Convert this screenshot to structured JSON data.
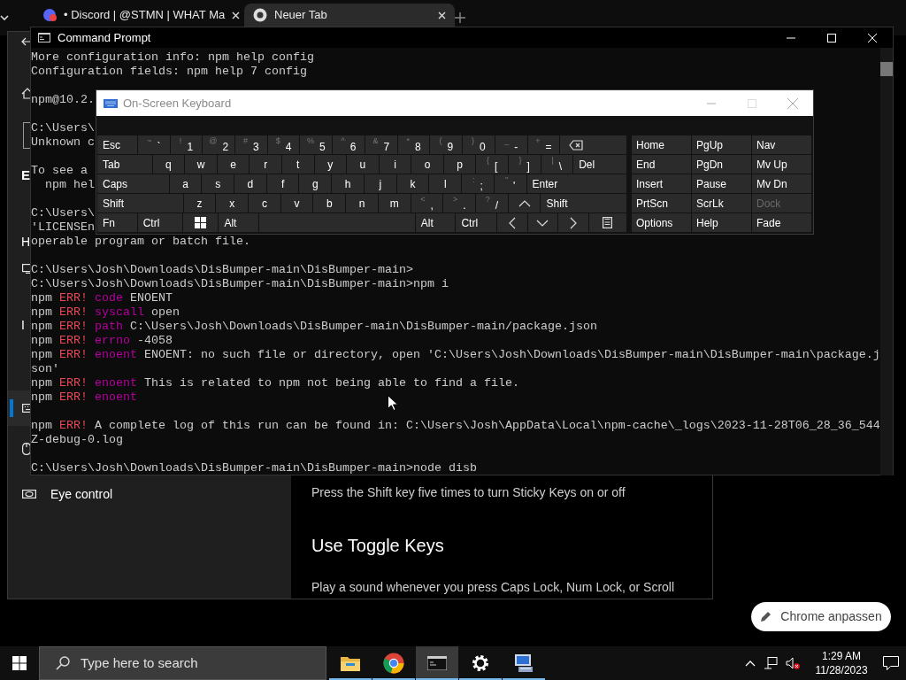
{
  "browser": {
    "tabs": [
      {
        "title": "• Discord | @STMN | WHAT Ma",
        "selected": false
      },
      {
        "title": "Neuer Tab",
        "selected": true
      }
    ],
    "customize_button": "Chrome anpassen"
  },
  "settings": {
    "sidebar": [
      {
        "kind": "back"
      },
      {
        "kind": "home"
      },
      {
        "kind": "search"
      },
      {
        "kind": "heading",
        "label": "E"
      },
      {
        "kind": "label",
        "label": "H"
      },
      {
        "kind": "item",
        "selected": false
      },
      {
        "kind": "label",
        "label": "I"
      },
      {
        "kind": "item",
        "selected": true
      },
      {
        "kind": "item",
        "selected": false
      },
      {
        "kind": "item",
        "label": "Eye control",
        "selected": false
      }
    ],
    "content": [
      {
        "kind": "text",
        "text": "Press the Shift key five times to turn Sticky Keys on or off"
      },
      {
        "kind": "heading",
        "text": "Use Toggle Keys"
      },
      {
        "kind": "text",
        "text": "Play a sound whenever you press Caps Lock, Num Lock, or Scroll"
      }
    ]
  },
  "console": {
    "title": "Command Prompt",
    "lines": [
      {
        "kind": "plain",
        "text": "More configuration info: npm help config"
      },
      {
        "kind": "plain",
        "text": "Configuration fields: npm help 7 config"
      },
      {
        "kind": "blank"
      },
      {
        "kind": "plain",
        "text": "npm@10.2."
      },
      {
        "kind": "blank"
      },
      {
        "kind": "plain",
        "text": "C:\\Users\\"
      },
      {
        "kind": "plain",
        "text": "Unknown c"
      },
      {
        "kind": "blank"
      },
      {
        "kind": "plain",
        "text": "To see a"
      },
      {
        "kind": "plain",
        "text": "  npm hel"
      },
      {
        "kind": "blank"
      },
      {
        "kind": "plain",
        "text": "C:\\Users\\"
      },
      {
        "kind": "plain",
        "text": "'LICENSEn"
      },
      {
        "kind": "plain",
        "text": "operable program or batch file."
      },
      {
        "kind": "blank"
      },
      {
        "kind": "plain",
        "text": "C:\\Users\\Josh\\Downloads\\DisBumper-main\\DisBumper-main>"
      },
      {
        "kind": "plain",
        "text": "C:\\Users\\Josh\\Downloads\\DisBumper-main\\DisBumper-main>npm i"
      },
      {
        "kind": "err",
        "prefix": "npm",
        "tag": "ERR!",
        "key": "code",
        "rest": "ENOENT"
      },
      {
        "kind": "err",
        "prefix": "npm",
        "tag": "ERR!",
        "key": "syscall",
        "rest": "open"
      },
      {
        "kind": "err",
        "prefix": "npm",
        "tag": "ERR!",
        "key": "path",
        "rest": "C:\\Users\\Josh\\Downloads\\DisBumper-main\\DisBumper-main/package.json"
      },
      {
        "kind": "err",
        "prefix": "npm",
        "tag": "ERR!",
        "key": "errno",
        "rest": "-4058"
      },
      {
        "kind": "err",
        "prefix": "npm",
        "tag": "ERR!",
        "key": "enoent",
        "rest": "ENOENT: no such file or directory, open 'C:\\Users\\Josh\\Downloads\\DisBumper-main\\DisBumper-main\\package.j"
      },
      {
        "kind": "plain",
        "text": "son'"
      },
      {
        "kind": "err",
        "prefix": "npm",
        "tag": "ERR!",
        "key": "enoent",
        "rest": "This is related to npm not being able to find a file."
      },
      {
        "kind": "err",
        "prefix": "npm",
        "tag": "ERR!",
        "key": "enoent"
      },
      {
        "kind": "blank"
      },
      {
        "kind": "err",
        "prefix": "npm",
        "tag": "ERR!",
        "rest": "A complete log of this run can be found in: C:\\Users\\Josh\\AppData\\Local\\npm-cache\\_logs\\2023-11-28T06_28_36_544"
      },
      {
        "kind": "plain",
        "text": "Z-debug-0.log"
      },
      {
        "kind": "blank"
      },
      {
        "kind": "plain",
        "text": "C:\\Users\\Josh\\Downloads\\DisBumper-main\\DisBumper-main>node disb"
      }
    ]
  },
  "keyboard": {
    "title": "On-Screen Keyboard",
    "rows": [
      [
        {
          "kind": "key",
          "label": "Esc"
        },
        {
          "kind": "dual",
          "shift": "~",
          "main": "`"
        },
        {
          "kind": "dual",
          "shift": "!",
          "main": "1"
        },
        {
          "kind": "dual",
          "shift": "@",
          "main": "2"
        },
        {
          "kind": "dual",
          "shift": "#",
          "main": "3"
        },
        {
          "kind": "dual",
          "shift": "$",
          "main": "4"
        },
        {
          "kind": "dual",
          "shift": "%",
          "main": "5"
        },
        {
          "kind": "dual",
          "shift": "^",
          "main": "6"
        },
        {
          "kind": "dual",
          "shift": "&",
          "main": "7"
        },
        {
          "kind": "dual",
          "shift": "*",
          "main": "8"
        },
        {
          "kind": "dual",
          "shift": "(",
          "main": "9"
        },
        {
          "kind": "dual",
          "shift": ")",
          "main": "0"
        },
        {
          "kind": "dual",
          "shift": "_",
          "main": "-"
        },
        {
          "kind": "dual",
          "shift": "+",
          "main": "="
        },
        {
          "kind": "backspace"
        }
      ],
      [
        {
          "kind": "key",
          "label": "Tab"
        },
        {
          "kind": "letter",
          "label": "q"
        },
        {
          "kind": "letter",
          "label": "w"
        },
        {
          "kind": "letter",
          "label": "e"
        },
        {
          "kind": "letter",
          "label": "r"
        },
        {
          "kind": "letter",
          "label": "t"
        },
        {
          "kind": "letter",
          "label": "y"
        },
        {
          "kind": "letter",
          "label": "u"
        },
        {
          "kind": "letter",
          "label": "i"
        },
        {
          "kind": "letter",
          "label": "o"
        },
        {
          "kind": "letter",
          "label": "p"
        },
        {
          "kind": "dual",
          "shift": "{",
          "main": "["
        },
        {
          "kind": "dual",
          "shift": "}",
          "main": "]"
        },
        {
          "kind": "dual",
          "shift": "|",
          "main": "\\"
        },
        {
          "kind": "key",
          "label": "Del"
        }
      ],
      [
        {
          "kind": "key",
          "label": "Caps"
        },
        {
          "kind": "letter",
          "label": "a"
        },
        {
          "kind": "letter",
          "label": "s"
        },
        {
          "kind": "letter",
          "label": "d"
        },
        {
          "kind": "letter",
          "label": "f"
        },
        {
          "kind": "letter",
          "label": "g"
        },
        {
          "kind": "letter",
          "label": "h"
        },
        {
          "kind": "letter",
          "label": "j"
        },
        {
          "kind": "letter",
          "label": "k"
        },
        {
          "kind": "letter",
          "label": "l"
        },
        {
          "kind": "dual",
          "shift": ":",
          "main": ";"
        },
        {
          "kind": "dual",
          "shift": "\"",
          "main": "'"
        },
        {
          "kind": "key",
          "label": "Enter"
        }
      ],
      [
        {
          "kind": "key",
          "label": "Shift"
        },
        {
          "kind": "letter",
          "label": "z"
        },
        {
          "kind": "letter",
          "label": "x"
        },
        {
          "kind": "letter",
          "label": "c"
        },
        {
          "kind": "letter",
          "label": "v"
        },
        {
          "kind": "letter",
          "label": "b"
        },
        {
          "kind": "letter",
          "label": "n"
        },
        {
          "kind": "letter",
          "label": "m"
        },
        {
          "kind": "dual",
          "shift": "<",
          "main": ","
        },
        {
          "kind": "dual",
          "shift": ">",
          "main": "."
        },
        {
          "kind": "dual",
          "shift": "?",
          "main": "/"
        },
        {
          "kind": "up"
        },
        {
          "kind": "key",
          "label": "Shift"
        }
      ],
      [
        {
          "kind": "key",
          "label": "Fn"
        },
        {
          "kind": "key",
          "label": "Ctrl"
        },
        {
          "kind": "windows"
        },
        {
          "kind": "key",
          "label": "Alt"
        },
        {
          "kind": "space"
        },
        {
          "kind": "key",
          "label": "Alt"
        },
        {
          "kind": "key",
          "label": "Ctrl"
        },
        {
          "kind": "left"
        },
        {
          "kind": "down"
        },
        {
          "kind": "right"
        },
        {
          "kind": "menu"
        }
      ]
    ],
    "nav": [
      [
        {
          "label": "Home",
          "disabled": false
        },
        {
          "label": "PgUp",
          "disabled": false
        },
        {
          "label": "Nav",
          "disabled": false
        }
      ],
      [
        {
          "label": "End",
          "disabled": false
        },
        {
          "label": "PgDn",
          "disabled": false
        },
        {
          "label": "Mv Up",
          "disabled": false
        }
      ],
      [
        {
          "label": "Insert",
          "disabled": false
        },
        {
          "label": "Pause",
          "disabled": false
        },
        {
          "label": "Mv Dn",
          "disabled": false
        }
      ],
      [
        {
          "label": "PrtScn",
          "disabled": false
        },
        {
          "label": "ScrLk",
          "disabled": false
        },
        {
          "label": "Dock",
          "disabled": true
        }
      ],
      [
        {
          "label": "Options",
          "disabled": false
        },
        {
          "label": "Help",
          "disabled": false
        },
        {
          "label": "Fade",
          "disabled": false
        }
      ]
    ]
  },
  "taskbar": {
    "search_placeholder": "Type here to search",
    "apps": [
      {
        "selected": false,
        "running": true
      },
      {
        "selected": false,
        "running": true
      },
      {
        "selected": true,
        "running": true
      },
      {
        "selected": false,
        "running": true
      },
      {
        "selected": false,
        "running": true
      }
    ],
    "time": "1:29 AM",
    "date": "11/28/2023"
  }
}
